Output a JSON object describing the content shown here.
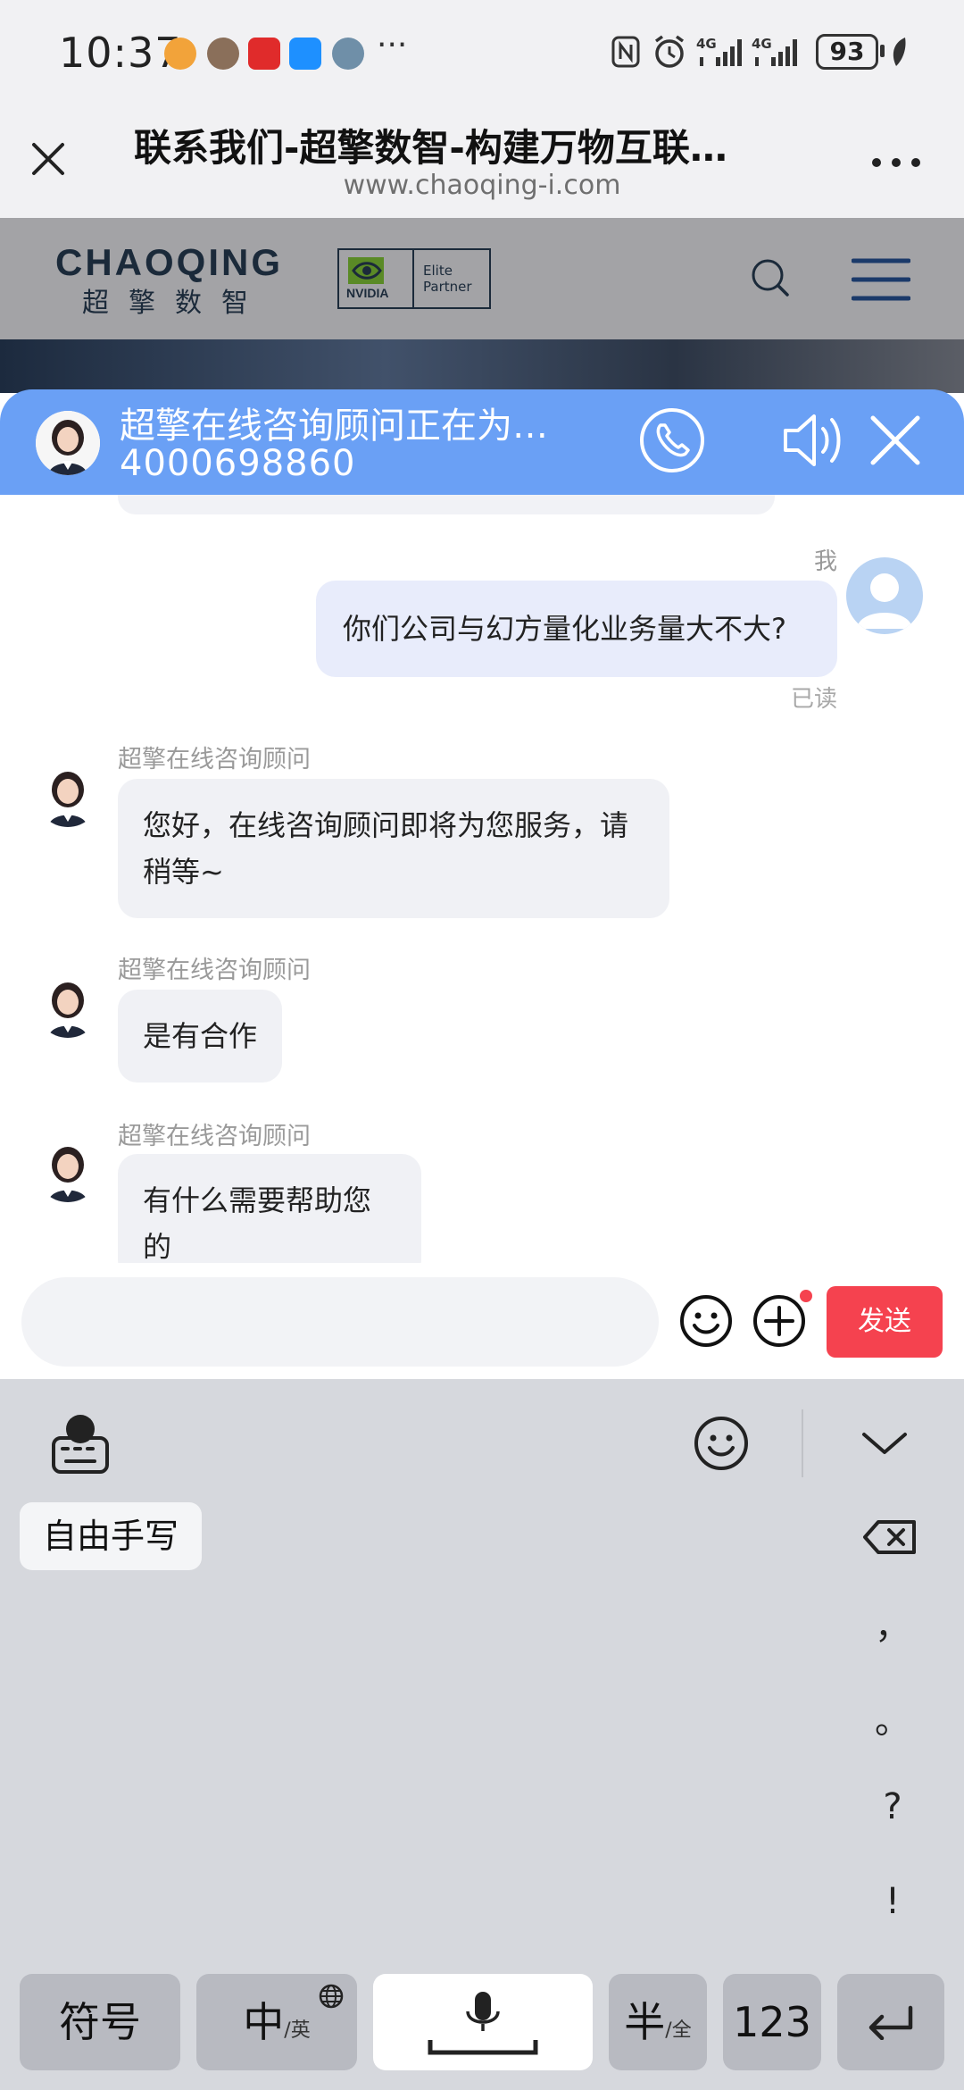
{
  "status_bar": {
    "time": "10:37",
    "more": "···",
    "battery": "93"
  },
  "browser": {
    "title": "联系我们-超擎数智-构建万物互联…",
    "url": "www.chaoqing-i.com",
    "close_icon": "close-icon",
    "menu_icon": "more-dots-icon"
  },
  "site": {
    "logo_text": "CHAOQING",
    "logo_cn": "超擎数智",
    "partner_brand": "NVIDIA",
    "partner_level": "Elite Partner"
  },
  "chat": {
    "header_title": "超擎在线咨询顾问正在为…",
    "phone": "4000698860",
    "me_label": "我",
    "read_label": "已读",
    "agent_name": "超擎在线咨询顾问",
    "messages": [
      {
        "from": "me",
        "text": "你们公司与幻方量化业务量大不大?"
      },
      {
        "from": "agent",
        "text": "您好，在线咨询顾问即将为您服务，请稍等~"
      },
      {
        "from": "agent",
        "text": "是有合作"
      },
      {
        "from": "agent",
        "text": "有什么需要帮助您的"
      }
    ],
    "input_value": "",
    "send_label": "发送"
  },
  "keyboard": {
    "handwriting_label": "自由手写",
    "punctuation": [
      "，",
      "。",
      "?",
      "!"
    ],
    "keys": {
      "symbols": "符号",
      "lang_main": "中",
      "lang_sub": "/英",
      "half_main": "半",
      "half_sub": "/全",
      "numbers": "123"
    }
  },
  "colors": {
    "chat_header": "#6aa0f5",
    "send_button": "#f5424f",
    "my_bubble": "#e8ecfb",
    "agent_bubble": "#f0f1f5"
  }
}
